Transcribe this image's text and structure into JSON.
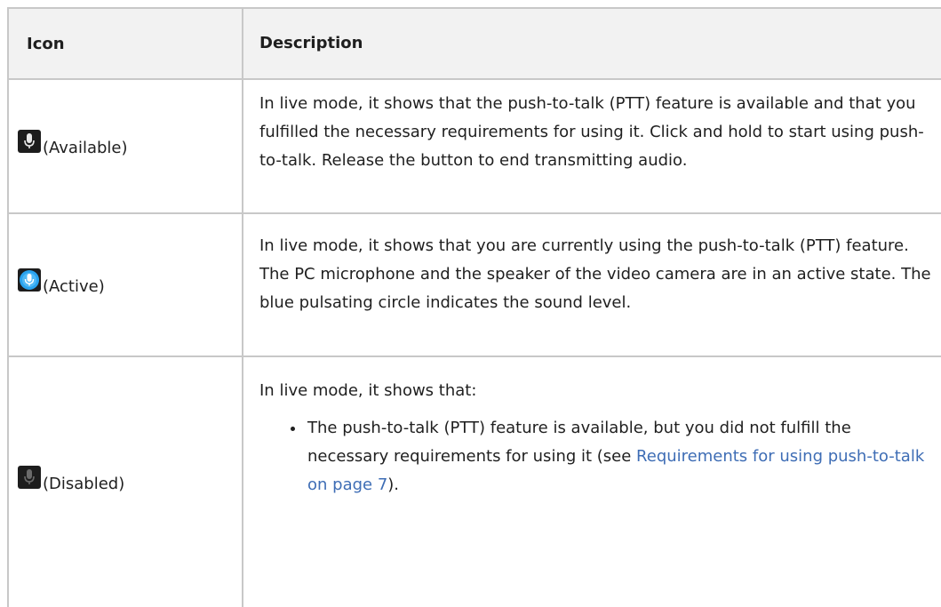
{
  "header": {
    "icon_col": "Icon",
    "desc_col": "Description"
  },
  "rows": [
    {
      "icon": "microphone-available-icon",
      "icon_label": "(Available)",
      "description": "In live mode, it shows that the push-to-talk (PTT) feature is available and that you fulfilled the necessary requirements for using it. Click and hold to start using push-to-talk. Release the button to end transmitting audio."
    },
    {
      "icon": "microphone-active-icon",
      "icon_label": "(Active)",
      "description": "In live mode, it shows that you are currently using the push-to-talk (PTT) feature. The PC microphone and the speaker of the video camera are in an active state. The blue pulsating circle indicates the sound level."
    },
    {
      "icon": "microphone-disabled-icon",
      "icon_label": "(Disabled)",
      "description_intro": "In live mode, it shows that:",
      "bullet_text": "The push-to-talk (PTT) feature is available, but you did not fulfill the necessary requirements for using it (see ",
      "bullet_link": "Requirements for using push-to-talk on page 7",
      "bullet_end": ")."
    }
  ],
  "colors": {
    "link": "#3e6db5",
    "active_blue": "#29a3ef",
    "header_bg": "#f2f2f2",
    "border": "#c8c8c8"
  }
}
